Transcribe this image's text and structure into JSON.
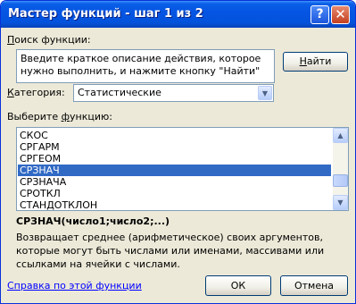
{
  "window": {
    "title": "Мастер функций - шаг 1 из 2",
    "help_button": "?",
    "close_button": "✕"
  },
  "search": {
    "label": "Поиск функции:",
    "value": "Введите краткое описание действия, которое нужно выполнить, и нажмите кнопку \"Найти\"",
    "find_button": "Найти"
  },
  "category": {
    "label": "Категория:",
    "selected": "Статистические"
  },
  "function_list": {
    "label": "Выберите функцию:",
    "items": [
      "СКОС",
      "СРГАРМ",
      "СРГЕОМ",
      "СРЗНАЧ",
      "СРЗНАЧА",
      "СРОТКЛ",
      "СТАНДОТКЛОН"
    ],
    "selected": "СРЗНАЧ"
  },
  "selected_function": {
    "signature": "СРЗНАЧ(число1;число2;...)",
    "description": "Возвращает среднее (арифметическое) своих аргументов, которые могут быть числами или именами, массивами или ссылками на ячейки с числами."
  },
  "footer": {
    "help_link": "Справка по этой функции",
    "ok_button": "ОК",
    "cancel_button": "Отмена"
  },
  "colors": {
    "title_bar": "#0554e3",
    "dialog_background": "#ece9d8",
    "selection": "#316ac5",
    "link": "#0000ff"
  },
  "icons": {
    "combo_arrow": "chevron-down-icon",
    "scroll_up": "scroll-up-icon",
    "scroll_down": "scroll-down-icon"
  }
}
